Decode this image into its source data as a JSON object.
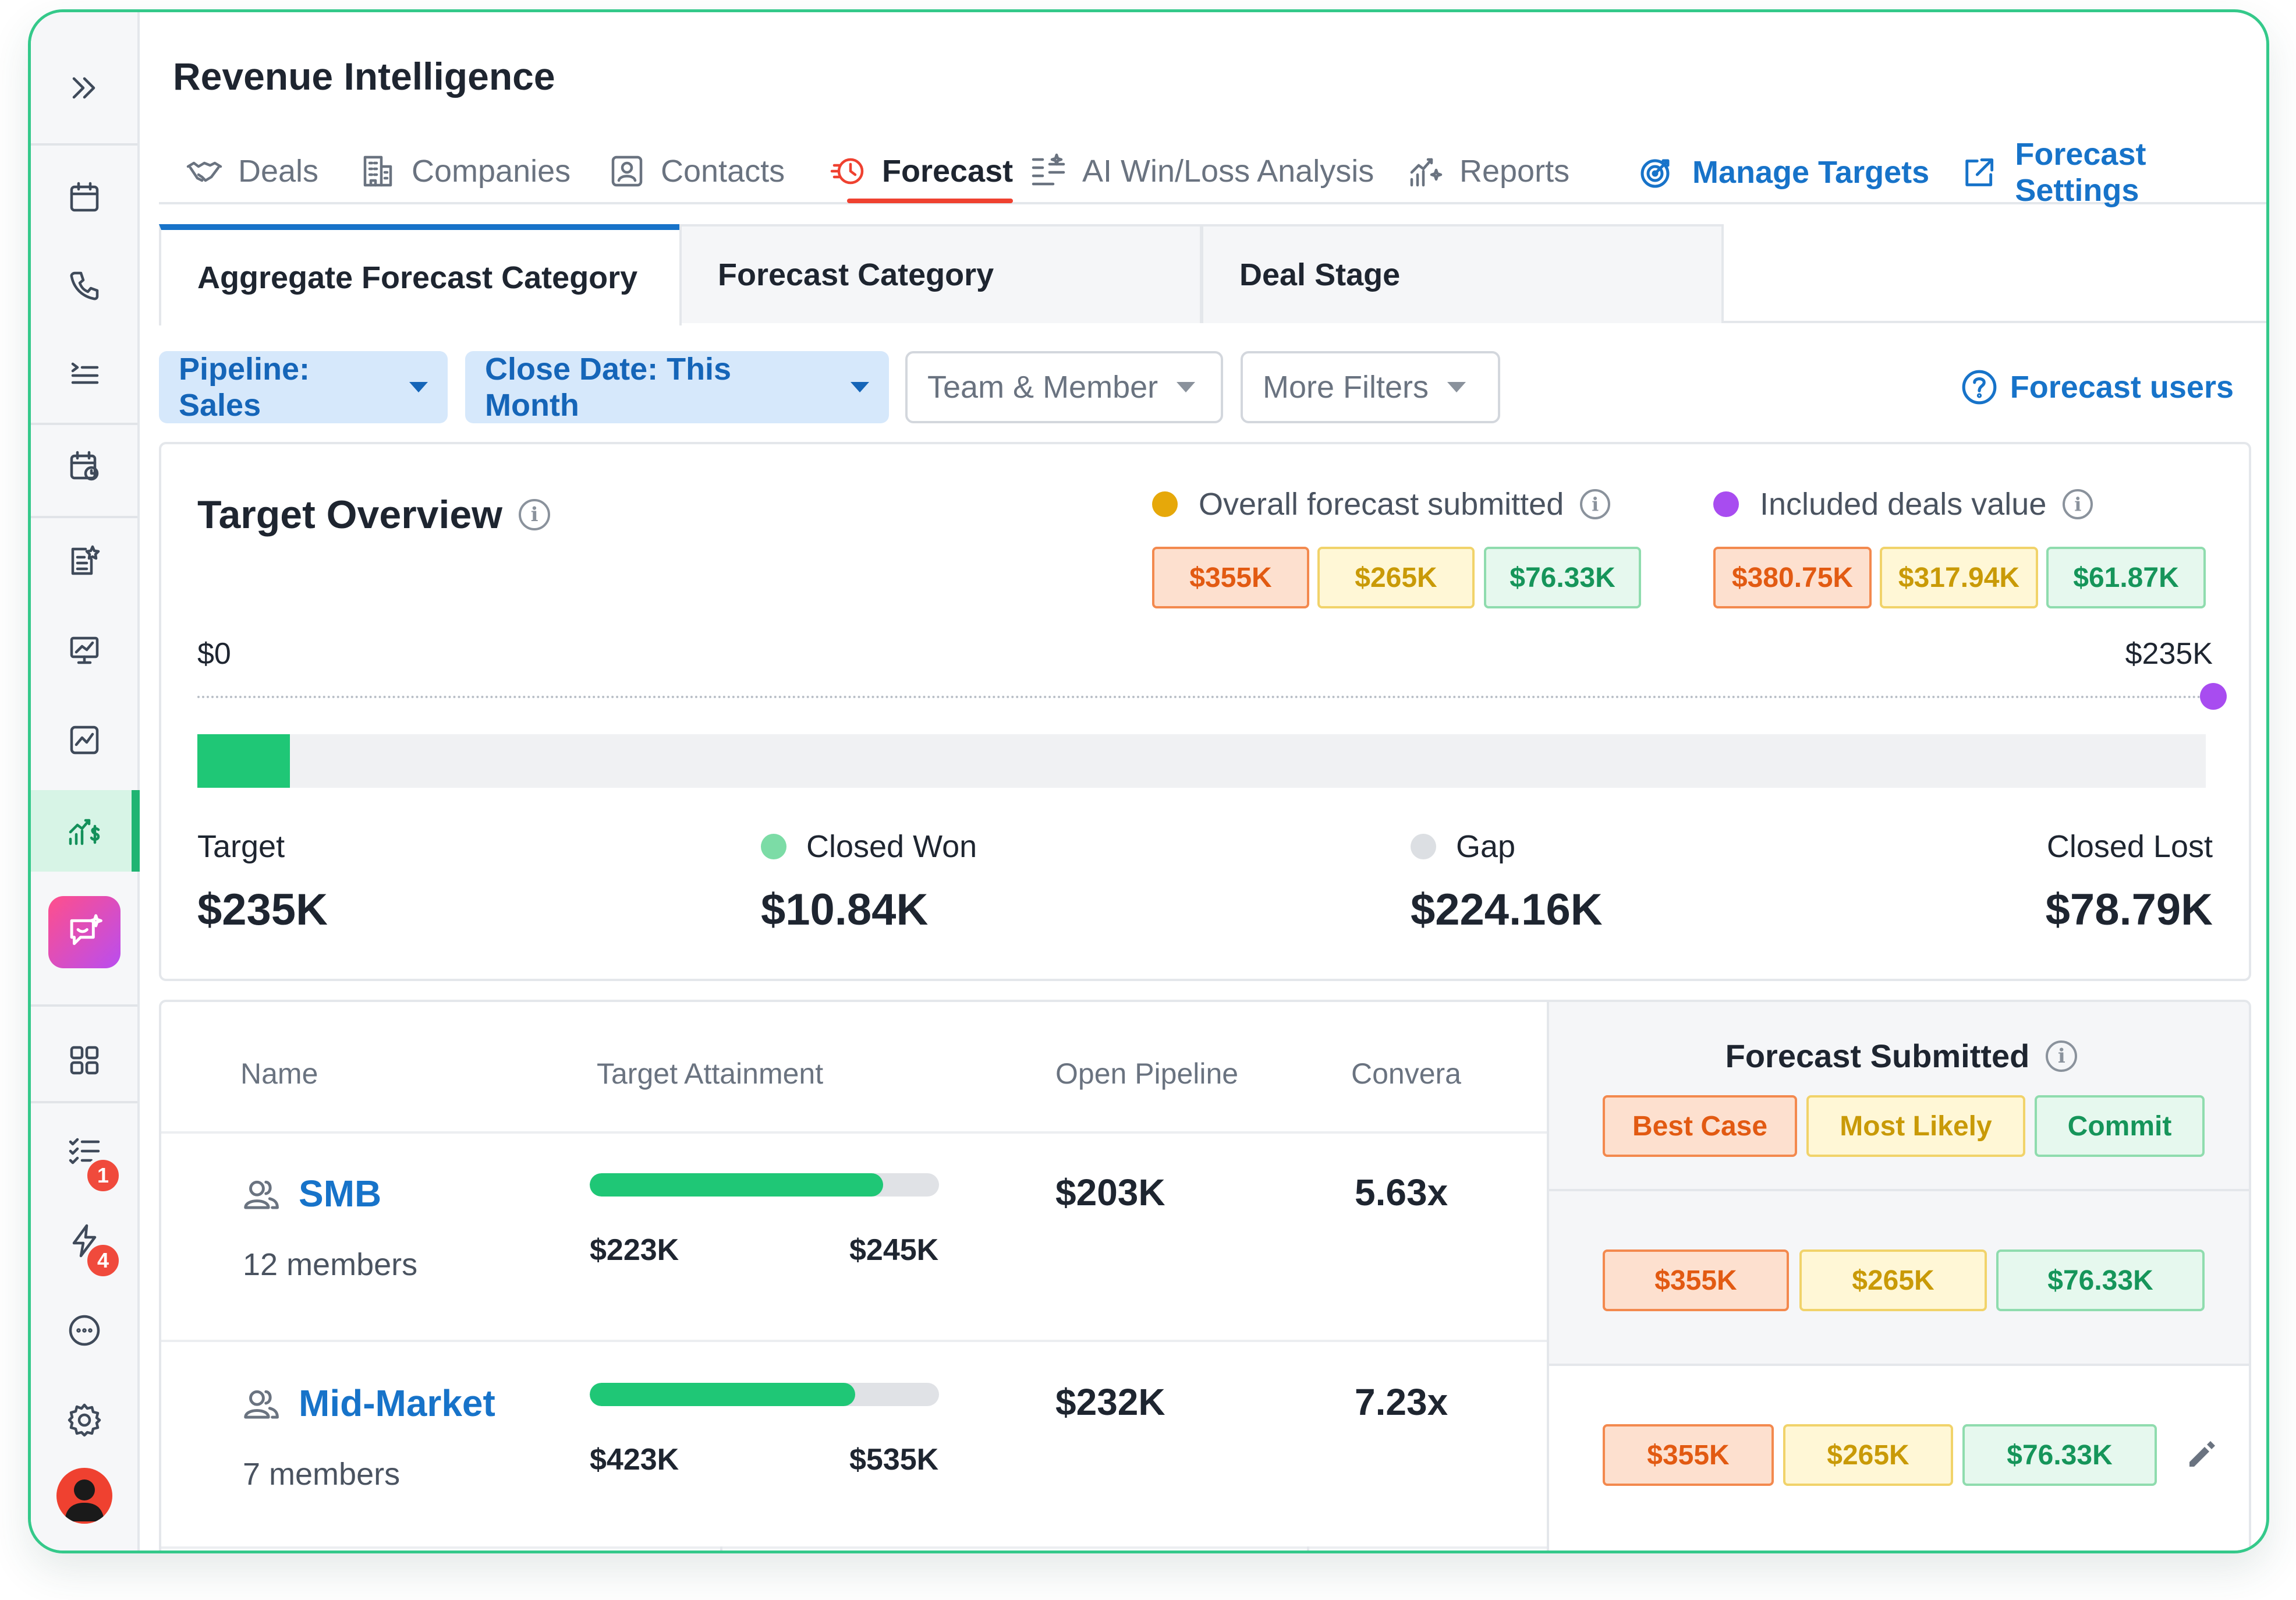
{
  "app": {
    "title": "Revenue Intelligence"
  },
  "nav": {
    "tabs": [
      {
        "label": "Deals",
        "icon": "handshake-icon"
      },
      {
        "label": "Companies",
        "icon": "building-icon"
      },
      {
        "label": "Contacts",
        "icon": "contact-card-icon"
      },
      {
        "label": "Forecast",
        "icon": "forecast-clock-icon",
        "active": true
      },
      {
        "label": "AI Win/Loss Analysis",
        "icon": "ai-list-icon"
      },
      {
        "label": "Reports",
        "icon": "reports-chart-icon"
      }
    ],
    "links": [
      {
        "label": "Manage Targets",
        "icon": "target-icon"
      },
      {
        "label": "Forecast Settings",
        "icon": "external-link-icon"
      }
    ]
  },
  "subtabs": [
    {
      "label": "Aggregate Forecast Category",
      "active": true
    },
    {
      "label": "Forecast Category"
    },
    {
      "label": "Deal Stage"
    }
  ],
  "filters": {
    "pipeline": "Pipeline: Sales",
    "close_date": "Close Date: This Month",
    "team": "Team & Member",
    "more": "More Filters",
    "help": "Forecast users"
  },
  "overview": {
    "title": "Target Overview",
    "legend_submitted": "Overall forecast submitted",
    "legend_included": "Included deals value",
    "submitted": {
      "best": "$355K",
      "likely": "$265K",
      "commit": "$76.33K"
    },
    "included": {
      "best": "$380.75K",
      "likely": "$317.94K",
      "commit": "$61.87K"
    },
    "scale_min": "$0",
    "scale_max": "$235K",
    "closed_won_fraction": 0.046,
    "stats": {
      "target_label": "Target",
      "target_value": "$235K",
      "won_label": "Closed Won",
      "won_value": "$10.84K",
      "gap_label": "Gap",
      "gap_value": "$224.16K",
      "lost_label": "Closed Lost",
      "lost_value": "$78.79K"
    }
  },
  "table": {
    "headers": {
      "name": "Name",
      "attainment": "Target Attainment",
      "pipeline": "Open Pipeline",
      "conversion": "Convera"
    },
    "forecast_submitted": "Forecast Submitted",
    "categories": {
      "best": "Best Case",
      "likely": "Most Likely",
      "commit": "Commit"
    },
    "rows": [
      {
        "name": "SMB",
        "members": "12 members",
        "attainment_fraction": 0.84,
        "achieved": "$223K",
        "target": "$245K",
        "pipeline": "$203K",
        "conversion": "5.63x",
        "best": "$355K",
        "likely": "$265K",
        "commit": "$76.33K"
      },
      {
        "name": "Mid-Market",
        "members": "7 members",
        "attainment_fraction": 0.76,
        "achieved": "$423K",
        "target": "$535K",
        "pipeline": "$232K",
        "conversion": "7.23x",
        "best": "$355K",
        "likely": "$265K",
        "commit": "$76.33K"
      }
    ]
  },
  "rail": {
    "badges": {
      "tasks": "1",
      "automations": "4"
    }
  },
  "colors": {
    "accent_blue": "#1773c9",
    "active_red": "#ef4130",
    "won_green": "#1fc776",
    "submitted_dot": "#e6a80a",
    "included_dot": "#a84cf0"
  }
}
